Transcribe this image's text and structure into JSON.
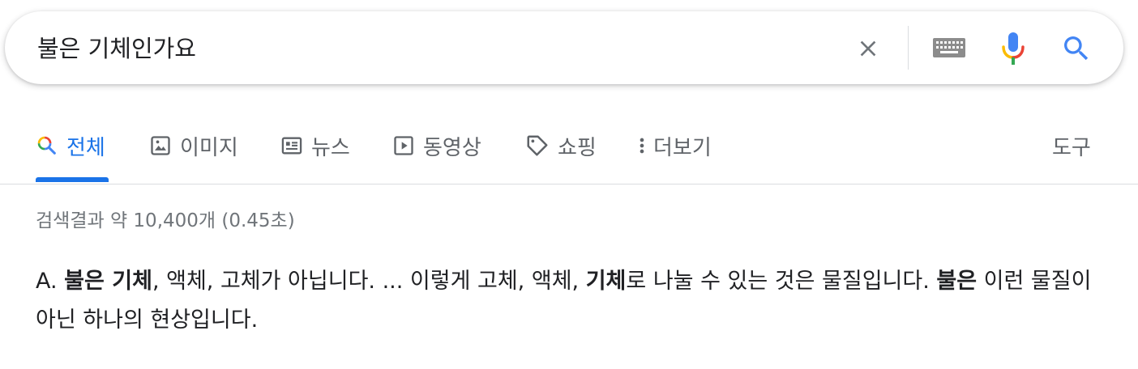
{
  "search": {
    "query": "불은 기체인가요"
  },
  "tabs": [
    {
      "label": "전체",
      "icon": "search-icon",
      "active": true
    },
    {
      "label": "이미지",
      "icon": "image-icon"
    },
    {
      "label": "뉴스",
      "icon": "news-icon"
    },
    {
      "label": "동영상",
      "icon": "video-icon"
    },
    {
      "label": "쇼핑",
      "icon": "tag-icon"
    },
    {
      "label": "더보기",
      "icon": "more-vert-icon"
    }
  ],
  "tools_label": "도구",
  "result_stats": "검색결과 약 10,400개 (0.45초)",
  "snippet": {
    "s1": "A. ",
    "b1": "불은 기체",
    "s2": ", 액체, 고체가 아닙니다. ... 이렇게 고체, 액체, ",
    "b2": "기체",
    "s3": "로 나눌 수 있는 것은 물질입니다. ",
    "b3": "불은",
    "s4": " 이런 물질이 아닌 하나의 현상입니다."
  },
  "colors": {
    "accent": "#1a73e8",
    "google_blue": "#4285f4",
    "google_red": "#ea4335",
    "google_yellow": "#fbbc04",
    "google_green": "#34a853",
    "muted_text": "#70757a",
    "tab_text": "#5f6368"
  }
}
